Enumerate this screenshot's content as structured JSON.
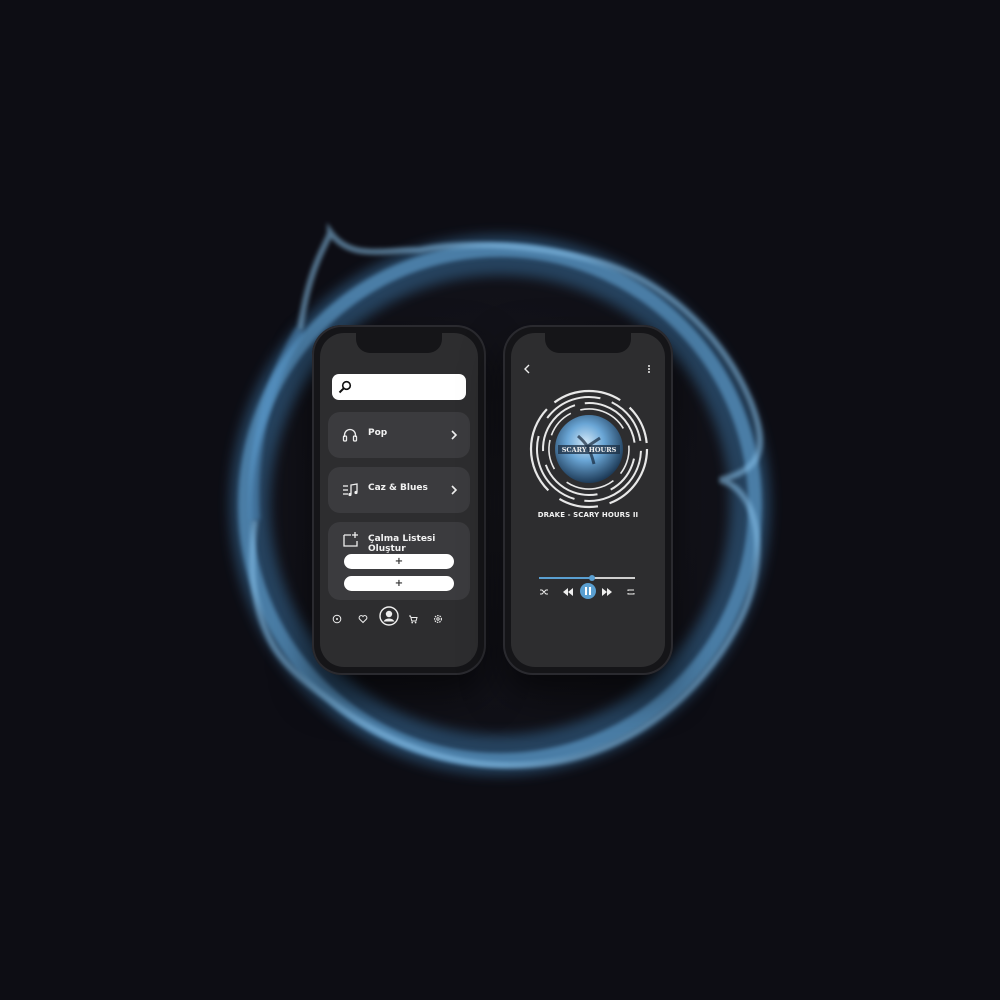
{
  "colors": {
    "accent": "#5a9fd1",
    "screen_bg": "#2d2d2f",
    "card_bg": "#3b3b3e",
    "page_bg": "#0d0d14"
  },
  "left_phone": {
    "search": {
      "value": "",
      "icon": "search-icon"
    },
    "genres": [
      {
        "label": "Pop",
        "icon": "headphones-icon"
      },
      {
        "label": "Caz & Blues",
        "icon": "music-list-icon"
      }
    ],
    "playlist": {
      "title": "Çalma Listesi Oluştur",
      "icon": "add-playlist-icon",
      "add_buttons": [
        "+",
        "+"
      ]
    },
    "nav": [
      "chat-icon",
      "heart-icon",
      "profile-icon",
      "cart-icon",
      "settings-icon"
    ]
  },
  "right_phone": {
    "back_icon": "back-chevron-icon",
    "menu_icon": "more-vertical-icon",
    "album_art_text": "SCARY HOURS",
    "track": "DRAKE - SCARY HOURS II",
    "progress": 0.55,
    "controls": [
      "shuffle-icon",
      "rewind-icon",
      "pause-icon",
      "fast-forward-icon",
      "repeat-icon"
    ]
  }
}
